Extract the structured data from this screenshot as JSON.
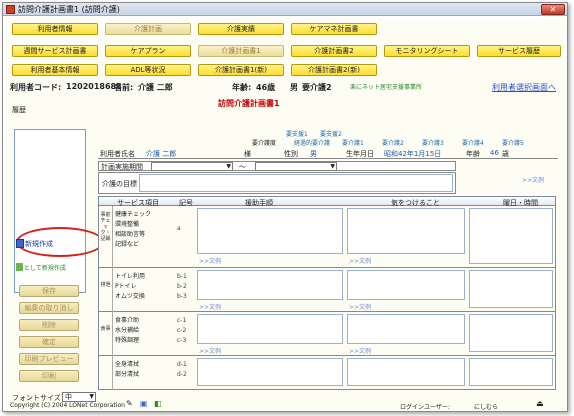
{
  "window": {
    "title": "訪問介護計画書1 (訪問介護)",
    "close_label": "✕"
  },
  "nav_row1": [
    "利用者情報",
    "介護計画",
    "介護実績",
    "ケアマネ計画書"
  ],
  "nav_row2": [
    "週間サービス計画書",
    "ケアプラン",
    "介護計画書1",
    "介護計画書2",
    "モニタリングシート",
    "サービス履歴"
  ],
  "nav_row3": [
    "利用者基本情報",
    "ADL等状況",
    "介護計画書1(新)",
    "介護計画書2(新)"
  ],
  "info": {
    "user_code_label": "利用者コード:",
    "user_code": "1202018688",
    "name_label": "名前:",
    "name": "介護 二郎",
    "age_label": "年齢:",
    "age": "46歳",
    "sex": "男",
    "care_level": "要介護2",
    "office": "楽にネット居宅支援事業所",
    "select_link": "利用者選択画面へ"
  },
  "doc_title": "訪問介護計画書1",
  "left": {
    "history_label": "履歴",
    "new_create": "新規作成",
    "as_new": "として新規作成",
    "buttons": [
      "保存",
      "編集の取り消し",
      "削除",
      "確定",
      "印刷プレビュー",
      "印刷"
    ],
    "font_size_label": "フォントサイズ",
    "font_size_value": "中"
  },
  "support": {
    "row1": [
      "要支援1",
      "要支援2"
    ],
    "care_label": "要介護度",
    "row2": [
      "経過的要介護",
      "要介護1",
      "要介護2",
      "要介護3",
      "要介護4",
      "要介護5"
    ]
  },
  "user_row": {
    "name_label": "利用者氏名",
    "name": "介護 二郎",
    "sama": "様",
    "sex_label": "性別",
    "sex": "男",
    "dob_label": "生年月日",
    "dob": "昭和42年1月15日",
    "age_label": "年齢",
    "age": "46",
    "age_unit": "歳"
  },
  "form": {
    "period_label": "計画実施期間",
    "tilde": "～",
    "goal_label": "介護の目標",
    "example": ">>文例"
  },
  "table": {
    "headers": [
      "サービス項目",
      "記号",
      "援助手順",
      "気をつけること",
      "曜日・時間"
    ],
    "rows": [
      {
        "category": "事前チェック・記録",
        "items": [
          "健康チェック",
          "環境整備",
          "相談助言等",
          "記録など"
        ],
        "codes": [
          "a"
        ]
      },
      {
        "category": "排泄",
        "items": [
          "トイレ利用",
          "Pトイレ",
          "オムツ交換"
        ],
        "codes": [
          "b-1",
          "b-2",
          "b-3"
        ]
      },
      {
        "category": "食事",
        "items": [
          "食事介助",
          "水分補給",
          "特殊調理"
        ],
        "codes": [
          "c-1",
          "c-2",
          "c-3"
        ]
      },
      {
        "category": "",
        "items": [
          "全身清拭",
          "部分清拭"
        ],
        "codes": [
          "d-1",
          "d-2"
        ]
      }
    ]
  },
  "status": {
    "copyright": "Copyright (C) 2004 LONet Corporation",
    "login_label": "ログインユーザー:",
    "login_user": "にしむら"
  },
  "colors": {
    "nav_yellow": "#ffdc30",
    "accent_red": "#c00000",
    "link_blue": "#2a4fc8",
    "highlight_oval": "#d8201a"
  }
}
